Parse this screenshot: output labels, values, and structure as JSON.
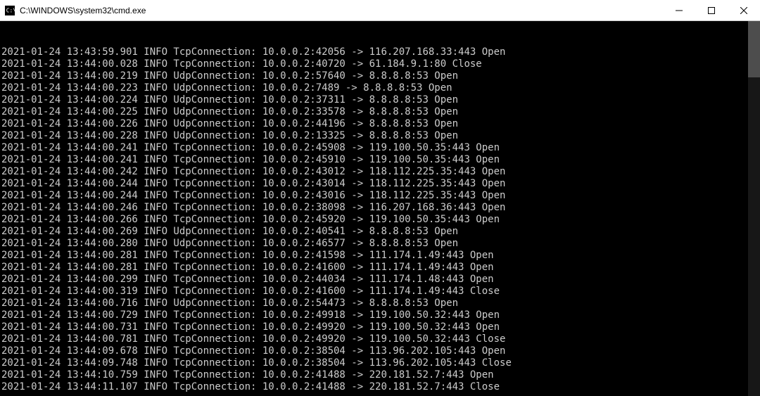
{
  "window": {
    "title": "C:\\WINDOWS\\system32\\cmd.exe"
  },
  "logs": [
    {
      "ts": "2021-01-24 13:43:59.901",
      "level": "INFO",
      "type": "TcpConnection:",
      "src": "10.0.0.2:42056",
      "arrow": "->",
      "dst": "116.207.168.33:443",
      "state": "Open"
    },
    {
      "ts": "2021-01-24 13:44:00.028",
      "level": "INFO",
      "type": "TcpConnection:",
      "src": "10.0.0.2:40720",
      "arrow": "->",
      "dst": "61.184.9.1:80",
      "state": "Close"
    },
    {
      "ts": "2021-01-24 13:44:00.219",
      "level": "INFO",
      "type": "UdpConnection:",
      "src": "10.0.0.2:57640",
      "arrow": "->",
      "dst": "8.8.8.8:53",
      "state": "Open"
    },
    {
      "ts": "2021-01-24 13:44:00.223",
      "level": "INFO",
      "type": "UdpConnection:",
      "src": "10.0.0.2:7489",
      "arrow": "->",
      "dst": "8.8.8.8:53",
      "state": "Open"
    },
    {
      "ts": "2021-01-24 13:44:00.224",
      "level": "INFO",
      "type": "UdpConnection:",
      "src": "10.0.0.2:37311",
      "arrow": "->",
      "dst": "8.8.8.8:53",
      "state": "Open"
    },
    {
      "ts": "2021-01-24 13:44:00.225",
      "level": "INFO",
      "type": "UdpConnection:",
      "src": "10.0.0.2:33578",
      "arrow": "->",
      "dst": "8.8.8.8:53",
      "state": "Open"
    },
    {
      "ts": "2021-01-24 13:44:00.226",
      "level": "INFO",
      "type": "UdpConnection:",
      "src": "10.0.0.2:44196",
      "arrow": "->",
      "dst": "8.8.8.8:53",
      "state": "Open"
    },
    {
      "ts": "2021-01-24 13:44:00.228",
      "level": "INFO",
      "type": "UdpConnection:",
      "src": "10.0.0.2:13325",
      "arrow": "->",
      "dst": "8.8.8.8:53",
      "state": "Open"
    },
    {
      "ts": "2021-01-24 13:44:00.241",
      "level": "INFO",
      "type": "TcpConnection:",
      "src": "10.0.0.2:45908",
      "arrow": "->",
      "dst": "119.100.50.35:443",
      "state": "Open"
    },
    {
      "ts": "2021-01-24 13:44:00.241",
      "level": "INFO",
      "type": "TcpConnection:",
      "src": "10.0.0.2:45910",
      "arrow": "->",
      "dst": "119.100.50.35:443",
      "state": "Open"
    },
    {
      "ts": "2021-01-24 13:44:00.242",
      "level": "INFO",
      "type": "TcpConnection:",
      "src": "10.0.0.2:43012",
      "arrow": "->",
      "dst": "118.112.225.35:443",
      "state": "Open"
    },
    {
      "ts": "2021-01-24 13:44:00.244",
      "level": "INFO",
      "type": "TcpConnection:",
      "src": "10.0.0.2:43014",
      "arrow": "->",
      "dst": "118.112.225.35:443",
      "state": "Open"
    },
    {
      "ts": "2021-01-24 13:44:00.244",
      "level": "INFO",
      "type": "TcpConnection:",
      "src": "10.0.0.2:43016",
      "arrow": "->",
      "dst": "118.112.225.35:443",
      "state": "Open"
    },
    {
      "ts": "2021-01-24 13:44:00.246",
      "level": "INFO",
      "type": "TcpConnection:",
      "src": "10.0.0.2:38098",
      "arrow": "->",
      "dst": "116.207.168.36:443",
      "state": "Open"
    },
    {
      "ts": "2021-01-24 13:44:00.266",
      "level": "INFO",
      "type": "TcpConnection:",
      "src": "10.0.0.2:45920",
      "arrow": "->",
      "dst": "119.100.50.35:443",
      "state": "Open"
    },
    {
      "ts": "2021-01-24 13:44:00.269",
      "level": "INFO",
      "type": "UdpConnection:",
      "src": "10.0.0.2:40541",
      "arrow": "->",
      "dst": "8.8.8.8:53",
      "state": "Open"
    },
    {
      "ts": "2021-01-24 13:44:00.280",
      "level": "INFO",
      "type": "UdpConnection:",
      "src": "10.0.0.2:46577",
      "arrow": "->",
      "dst": "8.8.8.8:53",
      "state": "Open"
    },
    {
      "ts": "2021-01-24 13:44:00.281",
      "level": "INFO",
      "type": "TcpConnection:",
      "src": "10.0.0.2:41598",
      "arrow": "->",
      "dst": "111.174.1.49:443",
      "state": "Open"
    },
    {
      "ts": "2021-01-24 13:44:00.281",
      "level": "INFO",
      "type": "TcpConnection:",
      "src": "10.0.0.2:41600",
      "arrow": "->",
      "dst": "111.174.1.49:443",
      "state": "Open"
    },
    {
      "ts": "2021-01-24 13:44:00.299",
      "level": "INFO",
      "type": "TcpConnection:",
      "src": "10.0.0.2:44034",
      "arrow": "->",
      "dst": "111.174.1.48:443",
      "state": "Open"
    },
    {
      "ts": "2021-01-24 13:44:00.319",
      "level": "INFO",
      "type": "TcpConnection:",
      "src": "10.0.0.2:41600",
      "arrow": "->",
      "dst": "111.174.1.49:443",
      "state": "Close"
    },
    {
      "ts": "2021-01-24 13:44:00.716",
      "level": "INFO",
      "type": "UdpConnection:",
      "src": "10.0.0.2:54473",
      "arrow": "->",
      "dst": "8.8.8.8:53",
      "state": "Open"
    },
    {
      "ts": "2021-01-24 13:44:00.729",
      "level": "INFO",
      "type": "TcpConnection:",
      "src": "10.0.0.2:49918",
      "arrow": "->",
      "dst": "119.100.50.32:443",
      "state": "Open"
    },
    {
      "ts": "2021-01-24 13:44:00.731",
      "level": "INFO",
      "type": "TcpConnection:",
      "src": "10.0.0.2:49920",
      "arrow": "->",
      "dst": "119.100.50.32:443",
      "state": "Open"
    },
    {
      "ts": "2021-01-24 13:44:00.781",
      "level": "INFO",
      "type": "TcpConnection:",
      "src": "10.0.0.2:49920",
      "arrow": "->",
      "dst": "119.100.50.32:443",
      "state": "Close"
    },
    {
      "ts": "2021-01-24 13:44:09.678",
      "level": "INFO",
      "type": "TcpConnection:",
      "src": "10.0.0.2:38504",
      "arrow": "->",
      "dst": "113.96.202.105:443",
      "state": "Open"
    },
    {
      "ts": "2021-01-24 13:44:09.748",
      "level": "INFO",
      "type": "TcpConnection:",
      "src": "10.0.0.2:38504",
      "arrow": "->",
      "dst": "113.96.202.105:443",
      "state": "Close"
    },
    {
      "ts": "2021-01-24 13:44:10.759",
      "level": "INFO",
      "type": "TcpConnection:",
      "src": "10.0.0.2:41488",
      "arrow": "->",
      "dst": "220.181.52.7:443",
      "state": "Open"
    },
    {
      "ts": "2021-01-24 13:44:11.107",
      "level": "INFO",
      "type": "TcpConnection:",
      "src": "10.0.0.2:41488",
      "arrow": "->",
      "dst": "220.181.52.7:443",
      "state": "Close"
    }
  ]
}
